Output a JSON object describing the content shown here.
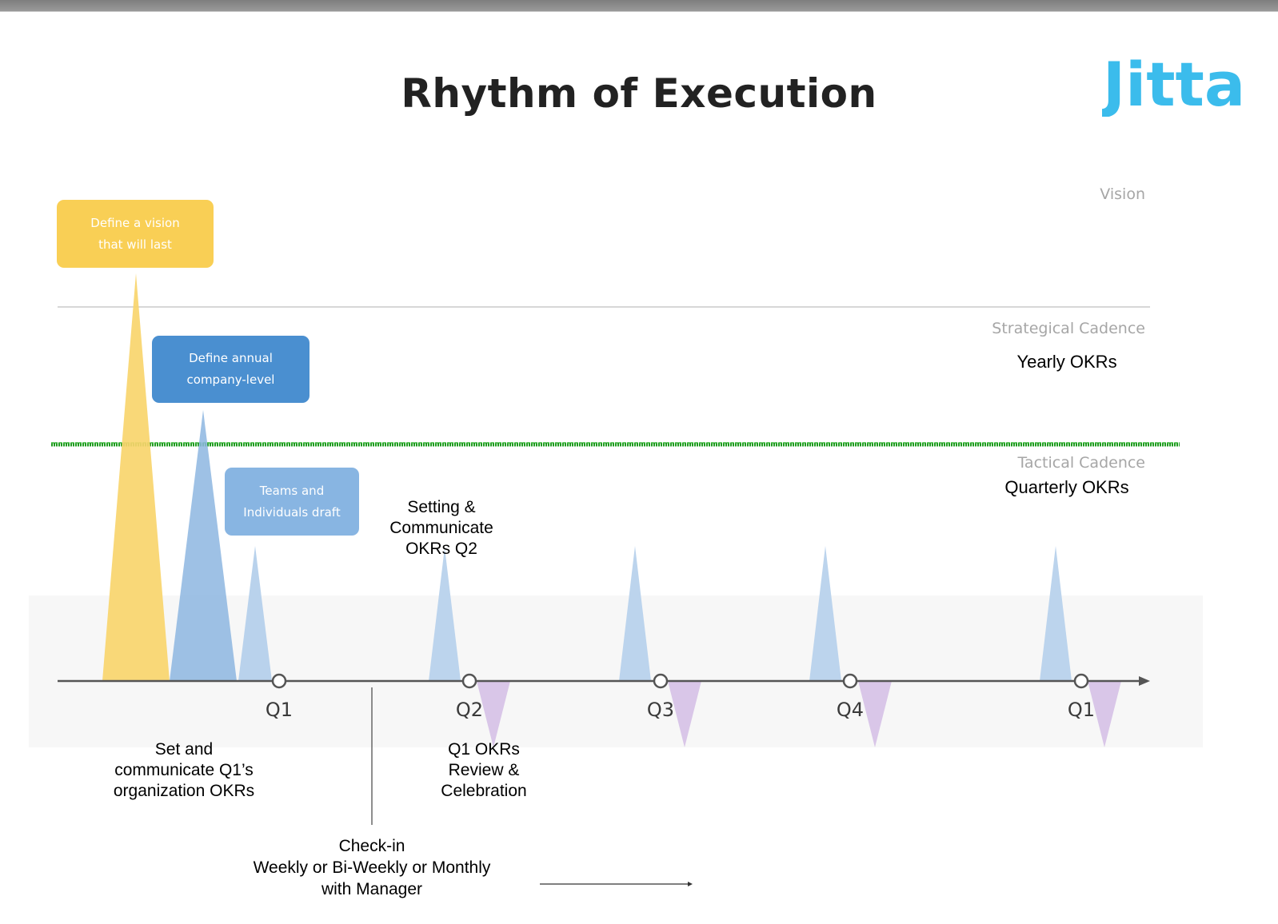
{
  "header": {
    "title": "Rhythm of Execution",
    "logo_text": "Jitta",
    "brand_color": "#3bbcec"
  },
  "bands": {
    "vision": "Vision",
    "strategic": "Strategical Cadence",
    "tactical": "Tactical Cadence"
  },
  "okr_labels": {
    "yearly": "Yearly OKRs",
    "quarterly": "Quarterly OKRs"
  },
  "boxes": {
    "vision": {
      "line1": "Define a vision",
      "line2": "that will last",
      "color": "#f9cf55"
    },
    "annual": {
      "line1": "Define annual",
      "line2": "company-level",
      "color": "#4a8fd0"
    },
    "teams": {
      "line1": "Teams and",
      "line2": "Individuals draft",
      "color": "#88b5e2"
    }
  },
  "timeline": {
    "quarters": [
      "Q1",
      "Q2",
      "Q3",
      "Q4",
      "Q1"
    ],
    "divider_color": "#1d9a1d"
  },
  "notes": {
    "setting": [
      "Setting &",
      "Communicate",
      "OKRs Q2"
    ],
    "set_q1": [
      "Set and",
      "communicate Q1’s",
      "organization OKRs"
    ],
    "review": [
      "Q1 OKRs",
      "Review &",
      "Celebration"
    ],
    "checkin": [
      "Check-in",
      "Weekly or Bi-Weekly or Monthly",
      "with Manager"
    ]
  }
}
